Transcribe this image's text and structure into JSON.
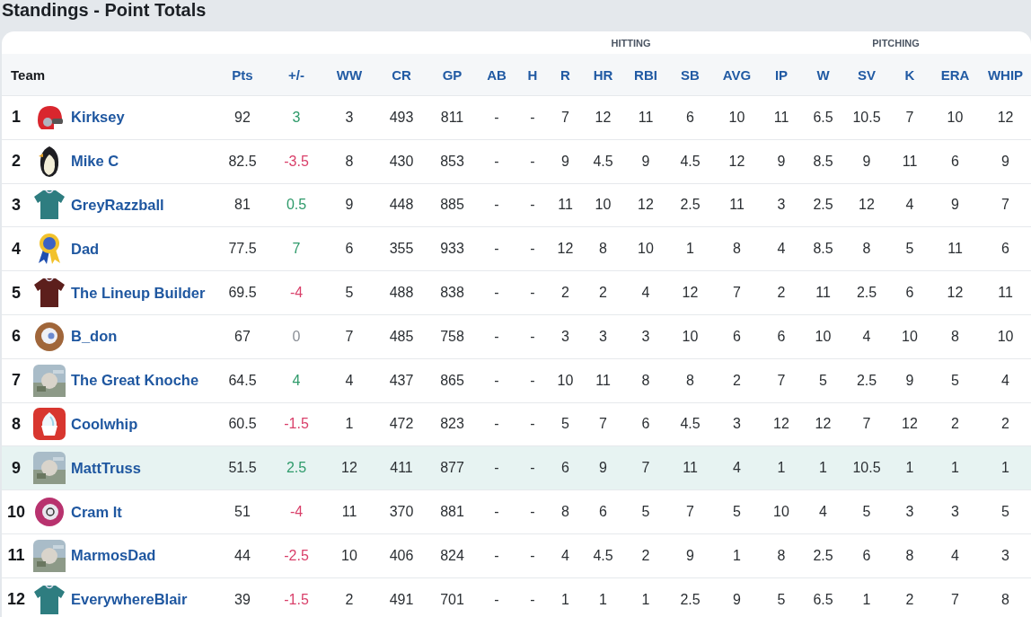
{
  "title": "Standings - Point Totals",
  "groups": [
    {
      "label": "HITTING"
    },
    {
      "label": "PITCHING"
    }
  ],
  "columns": {
    "team": "Team",
    "points": "Pts",
    "change": "+/-",
    "stats": [
      "WW",
      "CR",
      "GP",
      "AB",
      "H",
      "R",
      "HR",
      "RBI",
      "SB",
      "AVG",
      "IP",
      "W",
      "SV",
      "K",
      "ERA",
      "WHIP"
    ]
  },
  "rows": [
    {
      "rank": "1",
      "name": "Kirksey",
      "avatar": {
        "kind": "helmet"
      },
      "points": "92",
      "change": "3",
      "color": "#2e9a6a",
      "selected": false,
      "stats": [
        "3",
        "493",
        "811",
        "-",
        "-",
        "7",
        "12",
        "11",
        "6",
        "10",
        "11",
        "6.5",
        "10.5",
        "7",
        "10",
        "12"
      ]
    },
    {
      "rank": "2",
      "name": "Mike C",
      "avatar": {
        "kind": "penguin"
      },
      "points": "82.5",
      "change": "-3.5",
      "color": "#d9406a",
      "selected": false,
      "stats": [
        "8",
        "430",
        "853",
        "-",
        "-",
        "9",
        "4.5",
        "9",
        "4.5",
        "12",
        "9",
        "8.5",
        "9",
        "11",
        "6",
        "9"
      ]
    },
    {
      "rank": "3",
      "name": "GreyRazzball",
      "avatar": {
        "kind": "jersey",
        "color": "#2e7d80"
      },
      "points": "81",
      "change": "0.5",
      "color": "#2e9a6a",
      "selected": false,
      "stats": [
        "9",
        "448",
        "885",
        "-",
        "-",
        "11",
        "10",
        "12",
        "2.5",
        "11",
        "3",
        "2.5",
        "12",
        "4",
        "9",
        "7"
      ]
    },
    {
      "rank": "4",
      "name": "Dad",
      "avatar": {
        "kind": "ribbon"
      },
      "points": "77.5",
      "change": "7",
      "color": "#2e9a6a",
      "selected": false,
      "stats": [
        "6",
        "355",
        "933",
        "-",
        "-",
        "12",
        "8",
        "10",
        "1",
        "8",
        "4",
        "8.5",
        "8",
        "5",
        "11",
        "6"
      ]
    },
    {
      "rank": "5",
      "name": "The Lineup Builder",
      "avatar": {
        "kind": "jersey",
        "color": "#5c1f1c"
      },
      "points": "69.5",
      "change": "-4",
      "color": "#d9406a",
      "selected": false,
      "stats": [
        "5",
        "488",
        "838",
        "-",
        "-",
        "2",
        "2",
        "4",
        "12",
        "7",
        "2",
        "11",
        "2.5",
        "6",
        "12",
        "11"
      ]
    },
    {
      "rank": "6",
      "name": "B_don",
      "avatar": {
        "kind": "glove"
      },
      "points": "67",
      "change": "0",
      "color": "#8a8f96",
      "selected": false,
      "stats": [
        "7",
        "485",
        "758",
        "-",
        "-",
        "3",
        "3",
        "3",
        "10",
        "6",
        "6",
        "10",
        "4",
        "10",
        "8",
        "10"
      ]
    },
    {
      "rank": "7",
      "name": "The Great Knoche",
      "points": "64.5",
      "change": "4",
      "color": "#2e9a6a",
      "selected": false,
      "stats": [
        "4",
        "437",
        "865",
        "-",
        "-",
        "10",
        "11",
        "8",
        "8",
        "2",
        "7",
        "5",
        "2.5",
        "9",
        "5",
        "4"
      ]
    },
    {
      "rank": "8",
      "name": "Coolwhip",
      "avatar": {
        "kind": "cone"
      },
      "points": "60.5",
      "change": "-1.5",
      "color": "#d9406a",
      "selected": false,
      "stats": [
        "1",
        "472",
        "823",
        "-",
        "-",
        "5",
        "7",
        "6",
        "4.5",
        "3",
        "12",
        "12",
        "7",
        "12",
        "2",
        "2"
      ]
    },
    {
      "rank": "9",
      "name": "MattTruss",
      "points": "51.5",
      "change": "2.5",
      "color": "#2e9a6a",
      "selected": true,
      "stats": [
        "12",
        "411",
        "877",
        "-",
        "-",
        "6",
        "9",
        "7",
        "11",
        "4",
        "1",
        "1",
        "10.5",
        "1",
        "1",
        "1"
      ]
    },
    {
      "rank": "10",
      "name": "Cram It",
      "avatar": {
        "kind": "ball"
      },
      "points": "51",
      "change": "-4",
      "color": "#d9406a",
      "selected": false,
      "stats": [
        "11",
        "370",
        "881",
        "-",
        "-",
        "8",
        "6",
        "5",
        "7",
        "5",
        "10",
        "4",
        "5",
        "3",
        "3",
        "5"
      ]
    },
    {
      "rank": "11",
      "name": "MarmosDad",
      "points": "44",
      "change": "-2.5",
      "color": "#d9406a",
      "selected": false,
      "stats": [
        "10",
        "406",
        "824",
        "-",
        "-",
        "4",
        "4.5",
        "2",
        "9",
        "1",
        "8",
        "2.5",
        "6",
        "8",
        "4",
        "3"
      ]
    },
    {
      "rank": "12",
      "name": "EverywhereBlair",
      "avatar": {
        "kind": "jersey",
        "color": "#2e7d80"
      },
      "points": "39",
      "change": "-1.5",
      "color": "#d9406a",
      "selected": false,
      "stats": [
        "2",
        "491",
        "701",
        "-",
        "-",
        "1",
        "1",
        "1",
        "2.5",
        "9",
        "5",
        "6.5",
        "1",
        "2",
        "7",
        "8"
      ]
    }
  ]
}
